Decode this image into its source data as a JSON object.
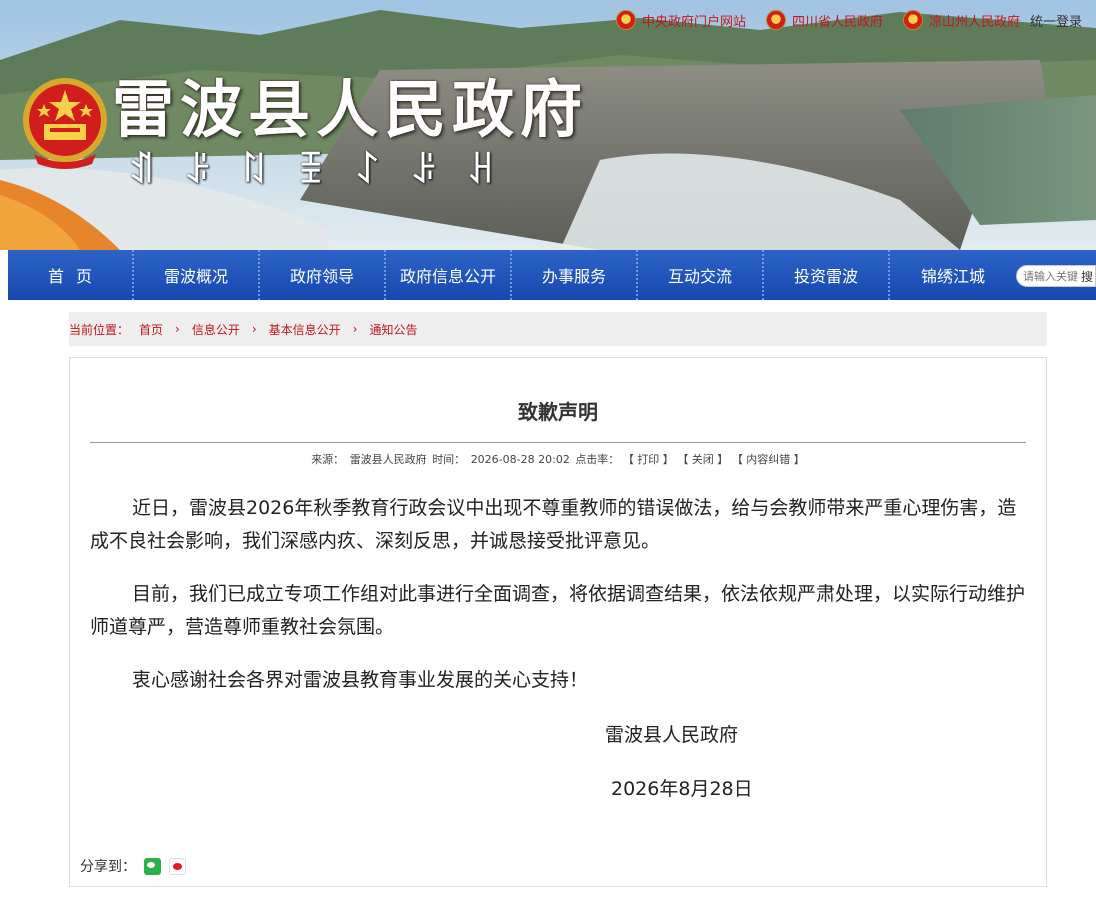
{
  "header": {
    "site_title": "雷波县人民政府",
    "yi_script": "ꀊꌠꇁꀨꋍꌠꃅ",
    "top_links": [
      {
        "label": "中央政府门户网站"
      },
      {
        "label": "四川省人民政府"
      },
      {
        "label": "凉山州人民政府"
      }
    ],
    "login_label": "统一登录",
    "emblem_icon": "national-emblem-icon"
  },
  "nav": {
    "items": [
      {
        "label": "首页"
      },
      {
        "label": "雷波概况"
      },
      {
        "label": "政府领导"
      },
      {
        "label": "政府信息公开"
      },
      {
        "label": "办事服务"
      },
      {
        "label": "互动交流"
      },
      {
        "label": "投资雷波"
      },
      {
        "label": "锦绣江城"
      }
    ],
    "search_placeholder": "请输入关键字",
    "search_button": "搜"
  },
  "breadcrumb": {
    "label": "当前位置：",
    "items": [
      "首页",
      "信息公开",
      "基本信息公开",
      "通知公告"
    ],
    "separator": "›"
  },
  "article": {
    "title": "致歉声明",
    "source_label": "来源：",
    "source": "雷波县人民政府",
    "time_label": "时间：",
    "time": "2026-08-28 20:02",
    "clicks_label": "点击率：",
    "print_label": "【 打印 】",
    "close_label": "【 关闭 】",
    "correct_label": "【 内容纠错 】",
    "paragraphs": [
      "近日，雷波县2026年秋季教育行政会议中出现不尊重教师的错误做法，给与会教师带来严重心理伤害，造成不良社会影响，我们深感内疚、深刻反思，并诚恳接受批评意见。",
      "目前，我们已成立专项工作组对此事进行全面调查，将依据调查结果，依法依规严肃处理，以实际行动维护师道尊严，营造尊师重教社会氛围。",
      "衷心感谢社会各界对雷波县教育事业发展的关心支持！"
    ],
    "signature_org": "雷波县人民政府",
    "signature_date": "2026年8月28日",
    "share_label": "分享到："
  },
  "colors": {
    "nav_blue": "#1e53b8",
    "link_red": "#c4151c",
    "crumb_bg": "#eeeeee"
  }
}
